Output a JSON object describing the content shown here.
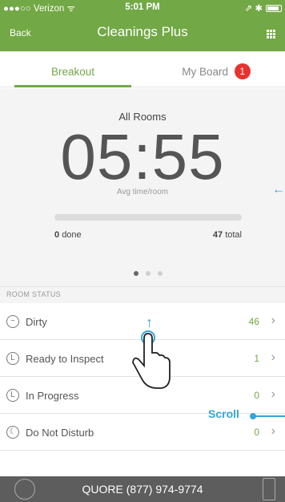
{
  "status_bar": {
    "carrier": "●●●○○ Verizon ᯤ",
    "time": "5:01 PM",
    "indicators": "⇗ ✱"
  },
  "nav": {
    "back_label": "Back",
    "title": "Cleanings Plus",
    "grid_icon": "grid-icon"
  },
  "tabs": [
    {
      "label": "Breakout",
      "active": true
    },
    {
      "label": "My Board",
      "badge": "1"
    }
  ],
  "summary": {
    "heading": "All Rooms",
    "avg_time": "05:55",
    "avg_label": "Avg time/room",
    "done_count": "0",
    "done_label": "done",
    "total_count": "47",
    "total_label": "total",
    "progress_fraction": 0.0,
    "page_dots": 3,
    "active_dot": 0
  },
  "room_status": {
    "header": "ROOM STATUS",
    "rows": [
      {
        "label": "Dirty",
        "count": "46",
        "icon": "minus-circle-icon"
      },
      {
        "label": "Ready to Inspect",
        "count": "1",
        "icon": "clock-icon"
      },
      {
        "label": "In Progress",
        "count": "0",
        "icon": "timer-icon"
      },
      {
        "label": "Do Not Disturb",
        "count": "0",
        "icon": "moon-icon"
      }
    ]
  },
  "tutorial": {
    "label": "Scroll"
  },
  "footer": {
    "phone": "QUORE (877) 974-9774"
  },
  "colors": {
    "brand_green": "#72a845",
    "badge_red": "#e8322e",
    "tutorial_blue": "#35a6d6"
  }
}
